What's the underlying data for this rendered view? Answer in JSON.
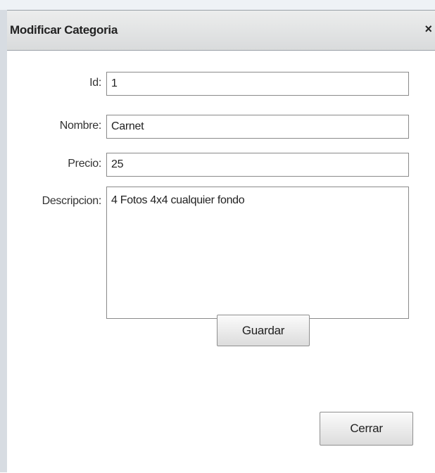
{
  "dialog": {
    "title": "Modificar Categoria",
    "close_glyph": "×"
  },
  "form": {
    "id": {
      "label": "Id:",
      "value": "1"
    },
    "nombre": {
      "label": "Nombre:",
      "value": "Carnet"
    },
    "precio": {
      "label": "Precio:",
      "value": "25"
    },
    "descripcion": {
      "label": "Descripcion:",
      "value": "4 Fotos 4x4 cualquier fondo"
    }
  },
  "buttons": {
    "save_label": "Guardar",
    "close_label": "Cerrar"
  }
}
